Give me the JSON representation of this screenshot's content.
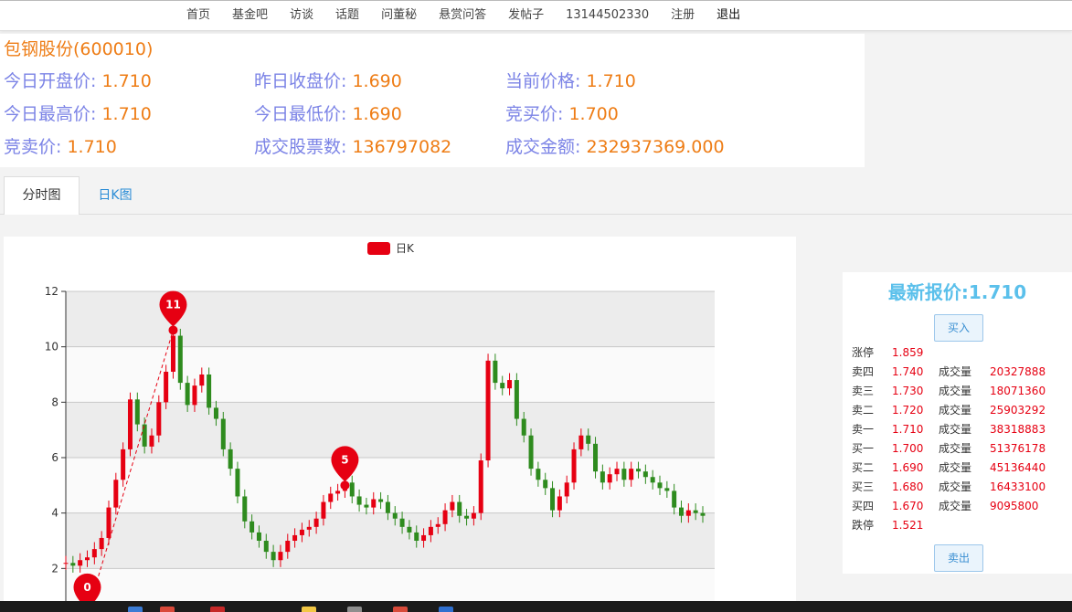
{
  "nav": {
    "items": [
      "首页",
      "基金吧",
      "访谈",
      "话题",
      "问董秘",
      "悬赏问答",
      "发帖子",
      "13144502330",
      "注册",
      "退出"
    ]
  },
  "stock": {
    "title": "包钢股份(600010)",
    "fields": [
      {
        "label": "今日开盘价: ",
        "value": "1.710"
      },
      {
        "label": "昨日收盘价: ",
        "value": "1.690"
      },
      {
        "label": "当前价格: ",
        "value": "1.710"
      },
      {
        "label": "今日最高价: ",
        "value": "1.710"
      },
      {
        "label": "今日最低价: ",
        "value": "1.690"
      },
      {
        "label": "竞买价: ",
        "value": "1.700"
      },
      {
        "label": "竞卖价: ",
        "value": "1.710"
      },
      {
        "label": "成交股票数: ",
        "value": "136797082"
      },
      {
        "label": "成交金额: ",
        "value": "232937369.000"
      }
    ]
  },
  "tabs": [
    "分时图",
    "日K图"
  ],
  "chart_data": {
    "type": "line",
    "legend": [
      "日K"
    ],
    "ylim": [
      0,
      12
    ],
    "yticks": [
      2,
      4,
      6,
      8,
      10,
      12
    ],
    "grid": true,
    "series": [
      {
        "name": "日K",
        "values": [
          2.2,
          2.1,
          2.3,
          2.4,
          2.7,
          3.1,
          4.2,
          5.2,
          6.3,
          8.1,
          7.2,
          6.4,
          6.8,
          8.0,
          9.1,
          10.4,
          8.7,
          7.9,
          8.6,
          9.0,
          7.8,
          7.4,
          6.3,
          5.6,
          4.6,
          3.7,
          3.3,
          3.0,
          2.6,
          2.3,
          2.6,
          3.0,
          3.2,
          3.4,
          3.5,
          3.8,
          4.4,
          4.7,
          4.8,
          5.1,
          4.6,
          4.3,
          4.2,
          4.5,
          4.4,
          4.0,
          3.8,
          3.5,
          3.3,
          3.0,
          3.2,
          3.5,
          3.6,
          4.1,
          4.4,
          3.9,
          3.8,
          4.0,
          5.9,
          9.5,
          8.7,
          8.5,
          8.8,
          7.4,
          6.8,
          5.6,
          5.2,
          4.9,
          4.1,
          4.6,
          5.1,
          6.3,
          6.8,
          6.5,
          5.5,
          5.1,
          5.4,
          5.6,
          5.2,
          5.6,
          5.5,
          5.3,
          5.1,
          4.9,
          4.8,
          4.2,
          3.9,
          4.1,
          4.0,
          3.9
        ]
      },
      {
        "name": "markers",
        "points": [
          {
            "label": "11",
            "x": 15,
            "y": 10.6
          },
          {
            "label": "5",
            "x": 39,
            "y": 5.0
          },
          {
            "label": "0",
            "x": 3,
            "y": 0.4
          }
        ]
      }
    ]
  },
  "side": {
    "latest": "最新报价:1.710",
    "buy": "买入",
    "sell": "卖出",
    "vol_label": "成交量",
    "book": [
      {
        "label": "涨停",
        "price": "1.859",
        "volume": ""
      },
      {
        "label": "卖四",
        "price": "1.740",
        "volume": "20327888"
      },
      {
        "label": "卖三",
        "price": "1.730",
        "volume": "18071360"
      },
      {
        "label": "卖二",
        "price": "1.720",
        "volume": "25903292"
      },
      {
        "label": "卖一",
        "price": "1.710",
        "volume": "38318883"
      },
      {
        "label": "买一",
        "price": "1.700",
        "volume": "51376178"
      },
      {
        "label": "买二",
        "price": "1.690",
        "volume": "45136440"
      },
      {
        "label": "买三",
        "price": "1.680",
        "volume": "16433100"
      },
      {
        "label": "买四",
        "price": "1.670",
        "volume": "9095800"
      },
      {
        "label": "跌停",
        "price": "1.521",
        "volume": ""
      }
    ]
  },
  "colors": {
    "accent": "#ee7d16",
    "label": "#7b83e6",
    "up": "#e60012",
    "down": "#2e8b1e",
    "link": "#2a8cd6"
  }
}
